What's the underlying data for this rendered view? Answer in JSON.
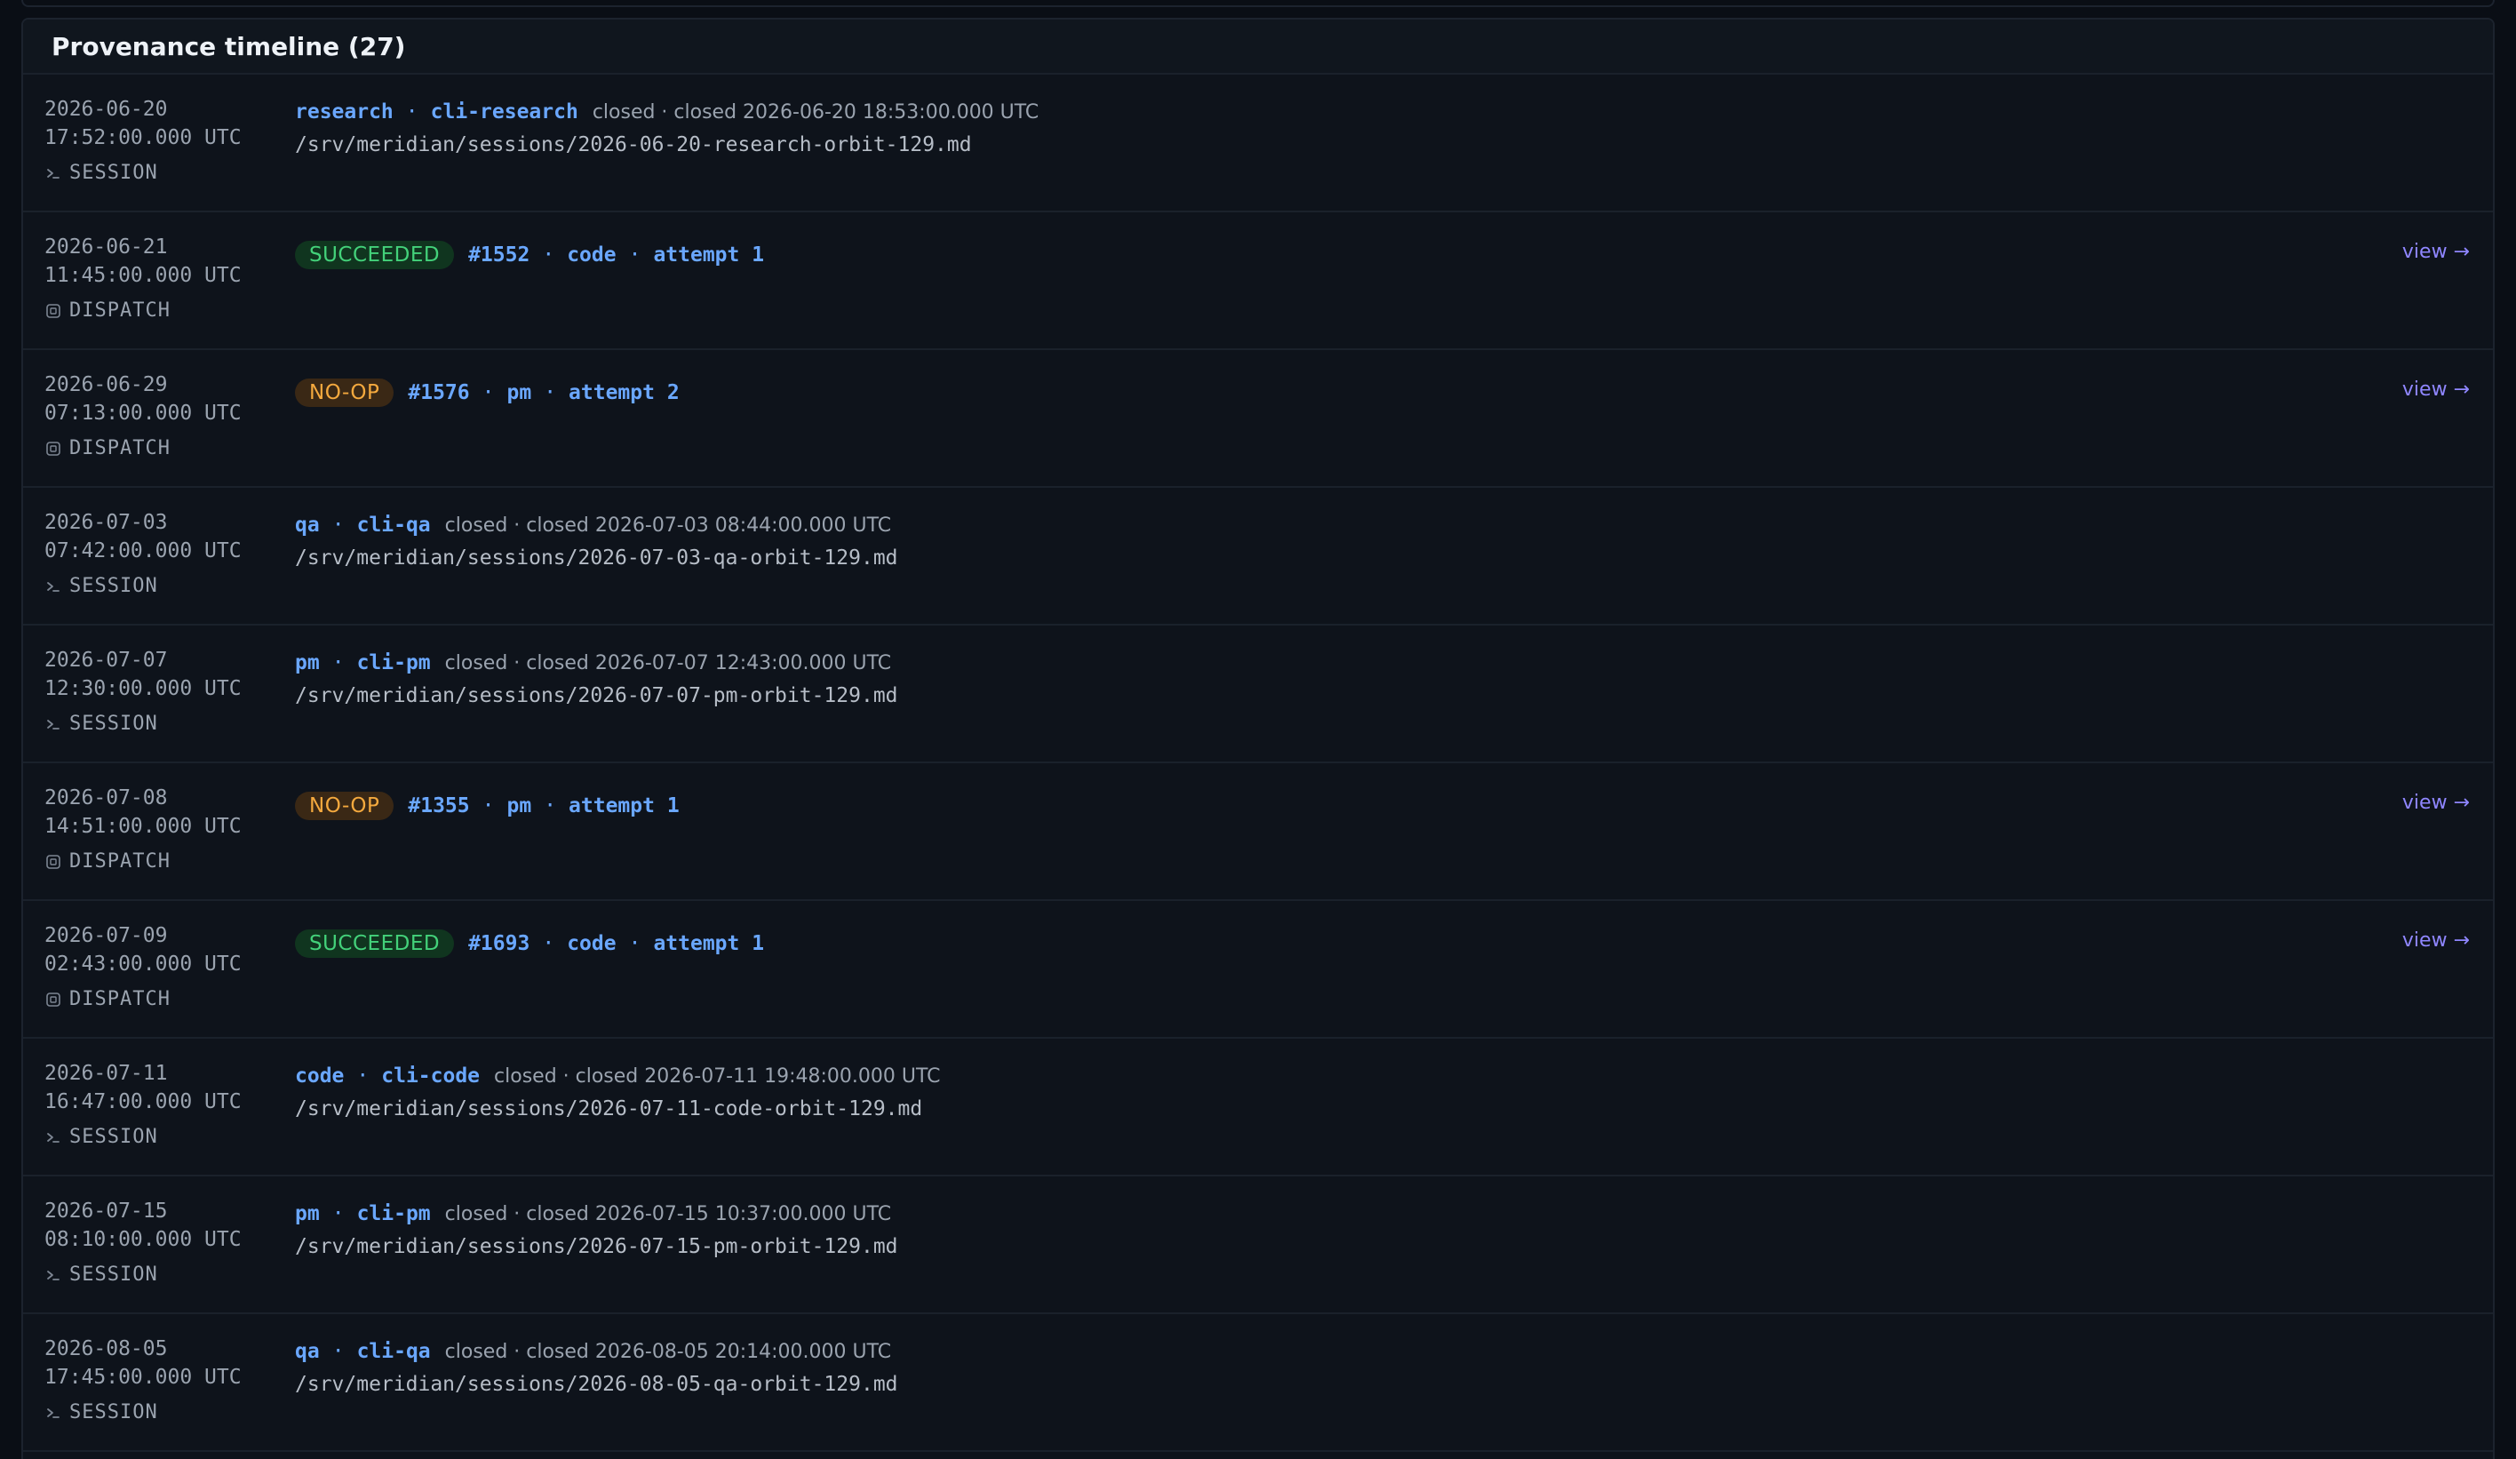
{
  "panel": {
    "title": "Provenance timeline (27)"
  },
  "colors": {
    "background": "#0a0e15",
    "panel": "#0e131b",
    "accent_blue": "#6aa7ff",
    "link_purple": "#8f86ff",
    "succeeded_text": "#43d17a",
    "succeeded_bg": "#10351f",
    "noop_text": "#f4a93e",
    "noop_bg": "#3a2815"
  },
  "rows": [
    {
      "type": "session",
      "date": "2026-06-20",
      "time": "17:52:00.000 UTC",
      "kind": "SESSION",
      "icon": "terminal-prompt-icon",
      "role": "research",
      "client": "cli-research",
      "closed": "closed · closed 2026-06-20 18:53:00.000 UTC",
      "path": "/srv/meridian/sessions/2026-06-20-research-orbit-129.md"
    },
    {
      "type": "dispatch",
      "date": "2026-06-21",
      "time": "11:45:00.000 UTC",
      "kind": "DISPATCH",
      "icon": "dispatch-box-icon",
      "status": "SUCCEEDED",
      "id": "#1552",
      "role": "code",
      "attempt": "attempt 1",
      "link": "view →"
    },
    {
      "type": "dispatch",
      "date": "2026-06-29",
      "time": "07:13:00.000 UTC",
      "kind": "DISPATCH",
      "icon": "dispatch-box-icon",
      "status": "NO-OP",
      "id": "#1576",
      "role": "pm",
      "attempt": "attempt 2",
      "link": "view →"
    },
    {
      "type": "session",
      "date": "2026-07-03",
      "time": "07:42:00.000 UTC",
      "kind": "SESSION",
      "icon": "terminal-prompt-icon",
      "role": "qa",
      "client": "cli-qa",
      "closed": "closed · closed 2026-07-03 08:44:00.000 UTC",
      "path": "/srv/meridian/sessions/2026-07-03-qa-orbit-129.md"
    },
    {
      "type": "session",
      "date": "2026-07-07",
      "time": "12:30:00.000 UTC",
      "kind": "SESSION",
      "icon": "terminal-prompt-icon",
      "role": "pm",
      "client": "cli-pm",
      "closed": "closed · closed 2026-07-07 12:43:00.000 UTC",
      "path": "/srv/meridian/sessions/2026-07-07-pm-orbit-129.md"
    },
    {
      "type": "dispatch",
      "date": "2026-07-08",
      "time": "14:51:00.000 UTC",
      "kind": "DISPATCH",
      "icon": "dispatch-box-icon",
      "status": "NO-OP",
      "id": "#1355",
      "role": "pm",
      "attempt": "attempt 1",
      "link": "view →"
    },
    {
      "type": "dispatch",
      "date": "2026-07-09",
      "time": "02:43:00.000 UTC",
      "kind": "DISPATCH",
      "icon": "dispatch-box-icon",
      "status": "SUCCEEDED",
      "id": "#1693",
      "role": "code",
      "attempt": "attempt 1",
      "link": "view →"
    },
    {
      "type": "session",
      "date": "2026-07-11",
      "time": "16:47:00.000 UTC",
      "kind": "SESSION",
      "icon": "terminal-prompt-icon",
      "role": "code",
      "client": "cli-code",
      "closed": "closed · closed 2026-07-11 19:48:00.000 UTC",
      "path": "/srv/meridian/sessions/2026-07-11-code-orbit-129.md"
    },
    {
      "type": "session",
      "date": "2026-07-15",
      "time": "08:10:00.000 UTC",
      "kind": "SESSION",
      "icon": "terminal-prompt-icon",
      "role": "pm",
      "client": "cli-pm",
      "closed": "closed · closed 2026-07-15 10:37:00.000 UTC",
      "path": "/srv/meridian/sessions/2026-07-15-pm-orbit-129.md"
    },
    {
      "type": "session",
      "date": "2026-08-05",
      "time": "17:45:00.000 UTC",
      "kind": "SESSION",
      "icon": "terminal-prompt-icon",
      "role": "qa",
      "client": "cli-qa",
      "closed": "closed · closed 2026-08-05 20:14:00.000 UTC",
      "path": "/srv/meridian/sessions/2026-08-05-qa-orbit-129.md"
    }
  ]
}
